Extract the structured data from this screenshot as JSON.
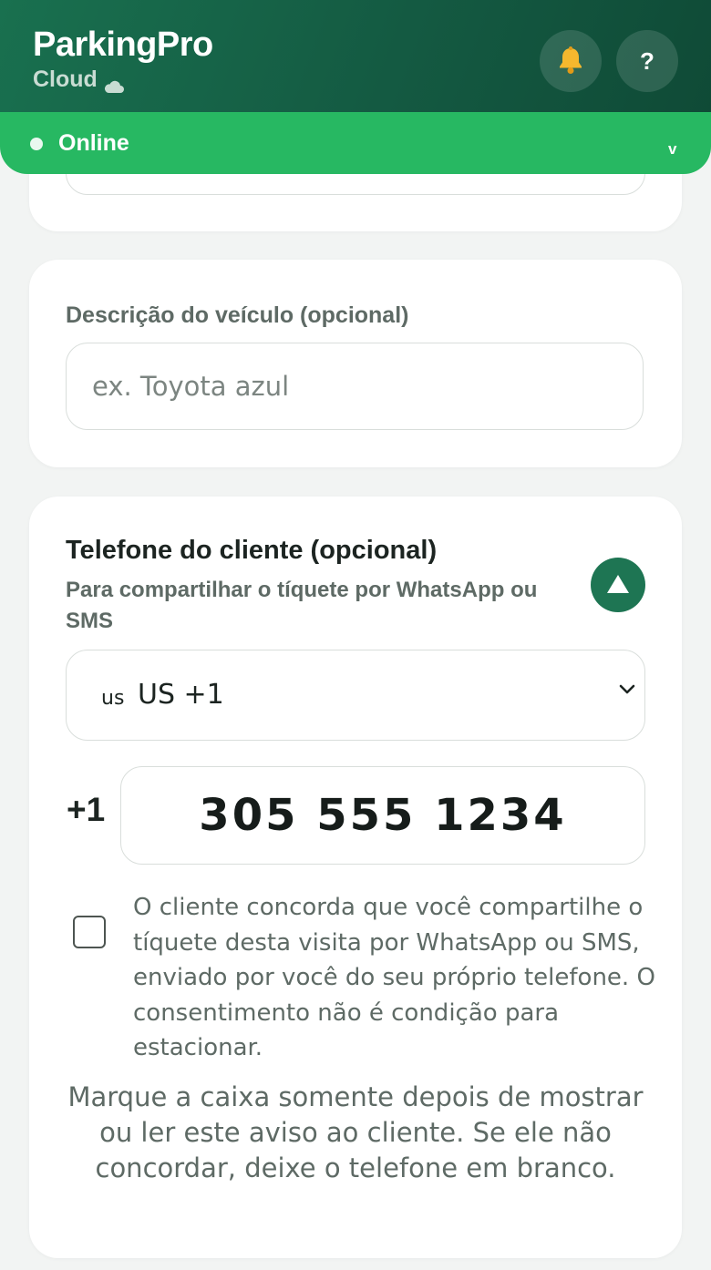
{
  "header": {
    "title": "ParkingPro",
    "subtitle": "Cloud",
    "bell_icon": "bell-icon",
    "help_label": "?"
  },
  "status": {
    "label": "Online",
    "chevron": "v",
    "color": "#27b862"
  },
  "vehicle": {
    "label": "Descrição do veículo (opcional)",
    "placeholder": "ex. Toyota azul",
    "value": ""
  },
  "phone": {
    "title": "Telefone do cliente (opcional)",
    "subtitle": "Para compartilhar o tíquete por WhatsApp ou SMS",
    "collapse_icon": "triangle-up-icon",
    "country_flag": "us",
    "country_value": "US +1",
    "prefix": "+1",
    "number": "305 555 1234",
    "consent_checked": false,
    "consent_text": "O cliente concorda que você compartilhe o tíquete desta visita por WhatsApp ou SMS, enviado por você do seu próprio telefone. O consentimento não é condição para estacionar.",
    "notice": "Marque a caixa somente depois de mostrar ou ler este aviso ao cliente. Se ele não concordar, deixe o telefone em branco."
  },
  "colors": {
    "header_bg": "#145a42",
    "accent_green": "#1e7553",
    "status_green": "#27b862"
  }
}
